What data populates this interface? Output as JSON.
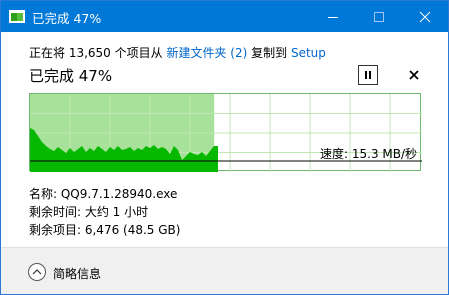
{
  "window": {
    "title": "已完成 47%",
    "icon": "copy-folder-icon",
    "colors": {
      "titlebar": "#0078d7",
      "graph_fill": "#a8e29a",
      "graph_line": "#07b800",
      "link": "#0066cc"
    }
  },
  "copy": {
    "prefix": "正在将 13,650 个项目从",
    "source": "新建文件夹 (2)",
    "middle": "复制到",
    "destination": "Setup"
  },
  "progress": {
    "title": "已完成 47%",
    "percent": 47
  },
  "graph": {
    "speed_label": "速度: 15.3 MB/秒"
  },
  "details": {
    "name": "名称:  QQ9.7.1.28940.exe",
    "time_remaining": "剩余时间:  大约 1 小时",
    "items_remaining": "剩余项目:  6,476 (48.5 GB)"
  },
  "footer": {
    "toggle_label": "简略信息"
  }
}
